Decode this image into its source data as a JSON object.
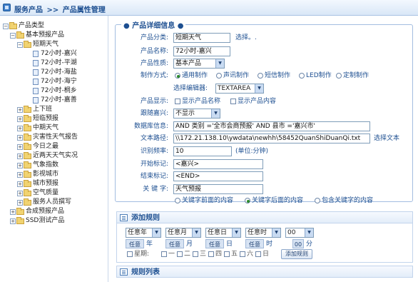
{
  "header": {
    "crumbs": [
      "服务产品",
      ">>",
      "产品属性管理"
    ]
  },
  "tree": {
    "root": "产品类型",
    "basic": "基本预报产品",
    "short": "短期天气",
    "leaves": [
      "72小时-嘉兴",
      "72小时-平湖",
      "72小时-海盐",
      "72小时-海宁",
      "72小时-桐乡",
      "72小时-嘉善"
    ],
    "groups": [
      "上下班",
      "短临预报",
      "中期天气",
      "灾害性天气报告",
      "今日之最",
      "近两天天气实况",
      "气象指数",
      "影视城市",
      "城市预报",
      "空气质量",
      "服务人员撰写"
    ],
    "composite": "合成预报产品",
    "ssd": "SSD测试产品"
  },
  "detail": {
    "legend": "产品详细信息",
    "category_label": "产品分类:",
    "category_value": "短期天气",
    "category_link": "选择。.",
    "name_label": "产品名称:",
    "name_value": "72小时-嘉兴",
    "nature_label": "产品性质:",
    "nature_value": "基本产品",
    "method_label": "制作方式:",
    "methods": [
      "通用制作",
      "声讯制作",
      "短信制作",
      "LED制作",
      "定制制作"
    ],
    "editor_label": "选择编辑器:",
    "editor_value": "TEXTAREA",
    "display_label": "产品显示:",
    "display_opts": [
      "显示产品名称",
      "显示产品内容"
    ],
    "follow_label": "跟随嘉兴:",
    "follow_value": "不显示",
    "db_label": "数据库信息:",
    "db_value": "AND 类别 ='全市会商预报' AND 县市 ='嘉兴市'",
    "path_label": "文本路径:",
    "path_value": "\\\\172.21.138.10\\ywdata\\newhh\\58452QuanShiDuanQi.txt",
    "path_link": "选择文本",
    "freq_label": "识别频率:",
    "freq_value": "10",
    "freq_unit": "(单位:分钟)",
    "start_label": "开始标记:",
    "start_value": "<嘉兴>",
    "end_label": "结束标记:",
    "end_value": "<END>",
    "kw_label": "关 键 字:",
    "kw_value": "天气预报",
    "kw_opts": [
      "关键字前面的内容",
      "关键字后面的内容",
      "包含关键字的内容"
    ]
  },
  "add_rule": {
    "title": "添加规则",
    "selects": [
      "任意年",
      "任意月",
      "任意日",
      "任意时",
      "00"
    ],
    "any_label": "任意",
    "units": [
      "年",
      "月",
      "日",
      "时",
      "分"
    ],
    "minute_value": "00",
    "week_label": "星期:",
    "weekdays": [
      "一",
      "二",
      "三",
      "四",
      "五",
      "六",
      "日"
    ],
    "add_button": "添加规则"
  },
  "rule_list": {
    "title": "规则列表"
  },
  "colors": {
    "accent": "#1d4f91",
    "border": "#a3bde0",
    "header_bg": "#d9e7f7"
  }
}
